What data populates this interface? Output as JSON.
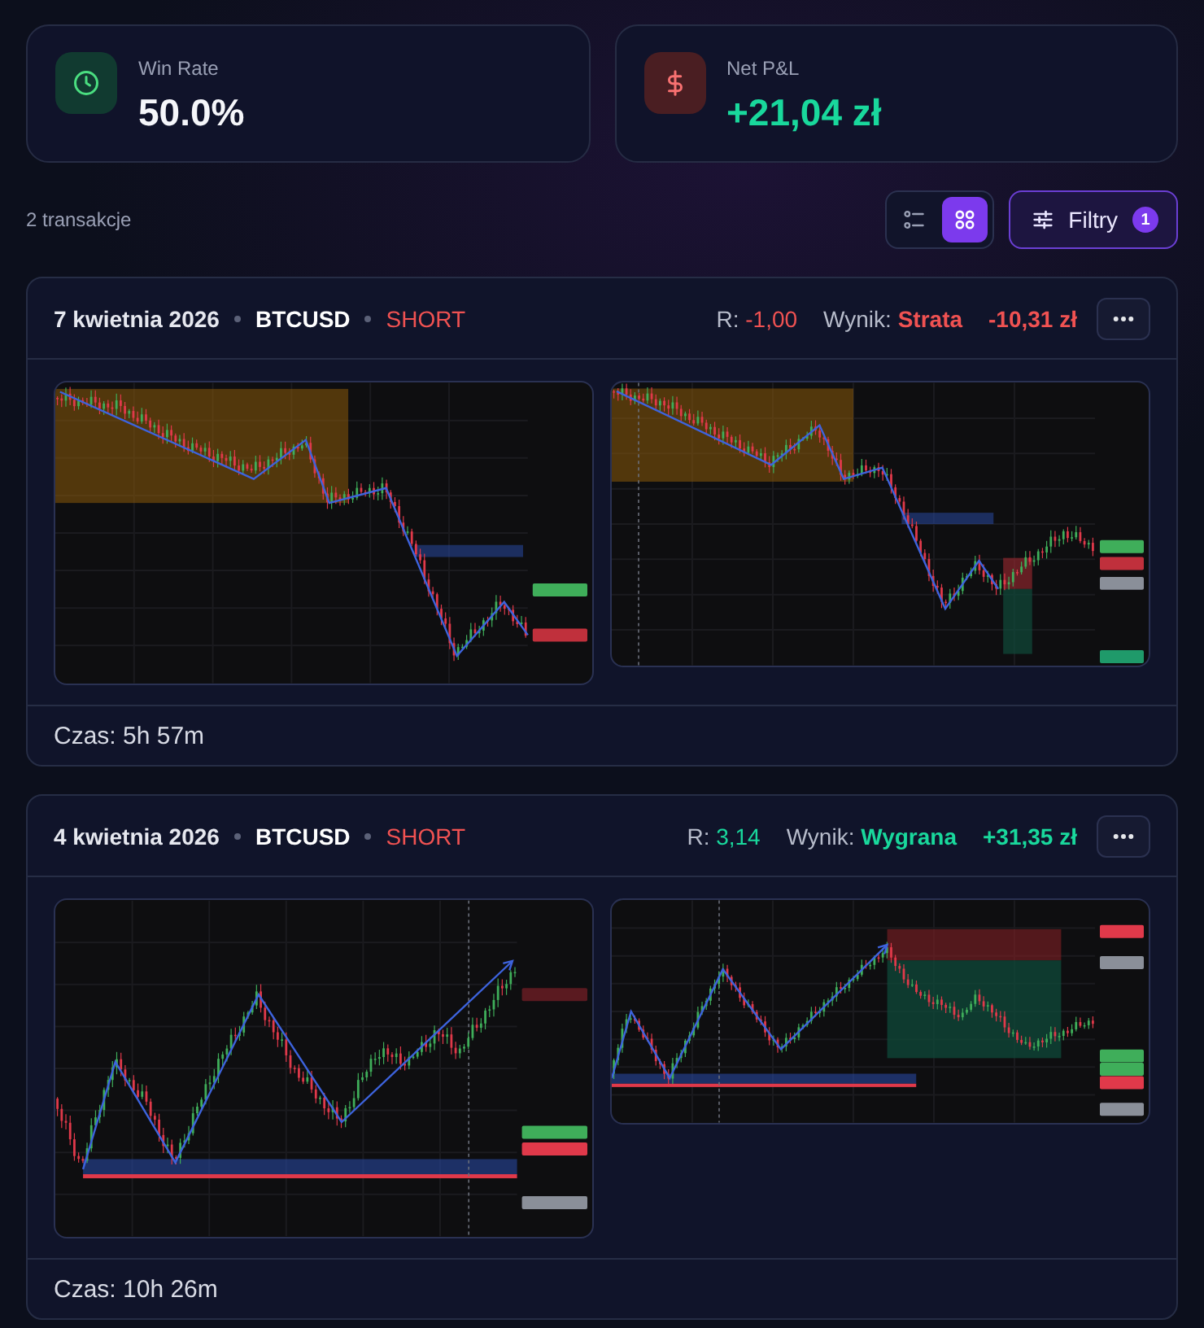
{
  "stats": [
    {
      "kind": "win_rate",
      "label": "Win Rate",
      "value": "50.0%",
      "positive": false
    },
    {
      "kind": "pnl",
      "label": "Net P&L",
      "value": "+21,04 zł",
      "positive": true
    }
  ],
  "toolbar": {
    "count": "2 transakcje",
    "view_modes": [
      {
        "kind": "list",
        "selected": false
      },
      {
        "kind": "grid",
        "selected": true
      }
    ],
    "filter": {
      "label": "Filtry",
      "badge": "1"
    }
  },
  "trades": [
    {
      "date": "7 kwietnia 2026",
      "symbol": "BTCUSD",
      "direction": {
        "text": "SHORT",
        "kind": "short"
      },
      "r": {
        "label": "R:",
        "value": "-1,00"
      },
      "result": {
        "label": "Wynik:",
        "value": "Strata"
      },
      "win": false,
      "pnl": "-10,31 zł",
      "screenshots": [
        {
          "kind": "chart"
        },
        {
          "kind": "chart"
        }
      ],
      "duration": "Czas: 5h 57m"
    },
    {
      "date": "4 kwietnia 2026",
      "symbol": "BTCUSD",
      "direction": {
        "text": "SHORT",
        "kind": "short"
      },
      "r": {
        "label": "R:",
        "value": "3,14"
      },
      "result": {
        "label": "Wynik:",
        "value": "Wygrana"
      },
      "win": true,
      "pnl": "+31,35 zł",
      "screenshots": [
        {
          "kind": "chart"
        },
        {
          "kind": "chart"
        }
      ],
      "duration": "Czas: 10h 26m"
    }
  ]
}
